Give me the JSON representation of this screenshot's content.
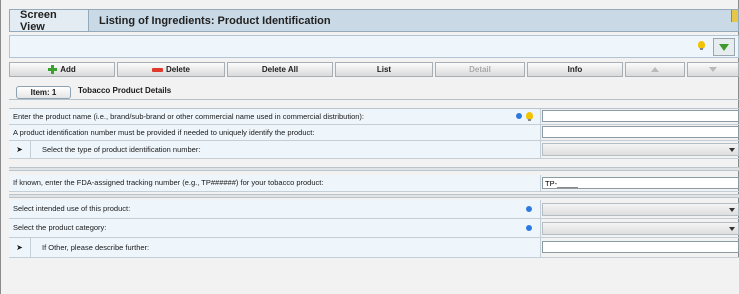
{
  "header": {
    "tab_screen_view": "Screen View",
    "title": "Listing of Ingredients: Product Identification"
  },
  "toolbar": {
    "add": "Add",
    "delete": "Delete",
    "delete_all": "Delete All",
    "list": "List",
    "detail": "Detail",
    "info": "Info"
  },
  "item": {
    "label": "Item: 1",
    "title": "Tobacco Product Details"
  },
  "rows": {
    "product_name": "Enter the product name (i.e., brand/sub-brand or other commercial name used in commercial distribution):",
    "product_id_note": "A product identification number must be provided if needed to uniquely identify the product:",
    "id_type": "Select the type of product identification number:",
    "tracking": "If known, enter the FDA-assigned tracking number (e.g., TP######) for your tobacco product:",
    "tracking_value": "TP-_____",
    "intended_use": "Select intended use of this product:",
    "category": "Select the product category:",
    "other_describe": "If Other, please describe further:"
  },
  "icons": {
    "hint": "lightbulb-icon",
    "info": "info-dot-icon",
    "download": "download-icon",
    "expand": "arrow-right-icon"
  },
  "colors": {
    "header_bg": "#c9d9e6",
    "row_label_bg": "#eef6fc",
    "info_dot": "#2d7be0",
    "hint_bulb": "#f2c300",
    "add_green": "#3aa12e",
    "delete_red": "#e0392c"
  }
}
